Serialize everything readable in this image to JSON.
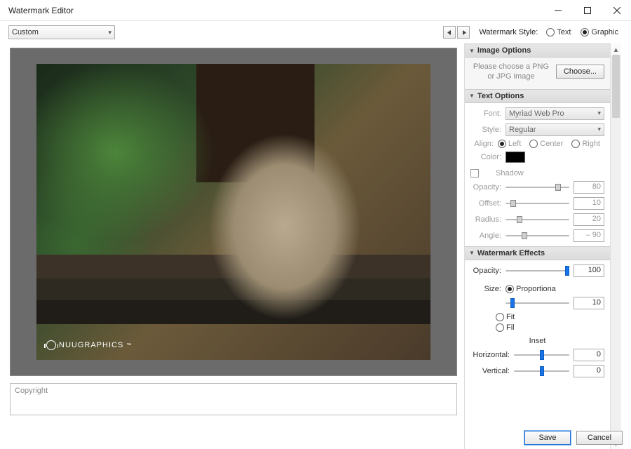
{
  "window": {
    "title": "Watermark Editor"
  },
  "toolbar": {
    "preset": "Custom",
    "watermark_style_label": "Watermark Style:",
    "style_text": "Text",
    "style_graphic": "Graphic",
    "style_selected": "Graphic"
  },
  "preview": {
    "watermark_text": "NUUGRAPHICS"
  },
  "copyright": {
    "placeholder": "Copyright"
  },
  "panels": {
    "image_options": {
      "title": "Image Options",
      "hint": "Please choose a PNG or JPG image",
      "choose_btn": "Choose..."
    },
    "text_options": {
      "title": "Text Options",
      "font_label": "Font:",
      "font_value": "Myriad Web Pro",
      "style_label": "Style:",
      "style_value": "Regular",
      "align_label": "Align:",
      "align_left": "Left",
      "align_center": "Center",
      "align_right": "Right",
      "color_label": "Color:",
      "shadow_label": "Shadow",
      "opacity_label": "Opacity:",
      "opacity_value": "80",
      "offset_label": "Offset:",
      "offset_value": "10",
      "radius_label": "Radius:",
      "radius_value": "20",
      "angle_label": "Angle:",
      "angle_value": "– 90"
    },
    "watermark_effects": {
      "title": "Watermark Effects",
      "opacity_label": "Opacity:",
      "opacity_value": "100",
      "size_label": "Size:",
      "size_proportional": "Proportiona",
      "size_value": "10",
      "size_fit": "Fit",
      "size_fill": "Fil",
      "inset_label": "Inset",
      "horizontal_label": "Horizontal:",
      "horizontal_value": "0",
      "vertical_label": "Vertical:",
      "vertical_value": "0"
    }
  },
  "footer": {
    "save": "Save",
    "cancel": "Cancel"
  }
}
